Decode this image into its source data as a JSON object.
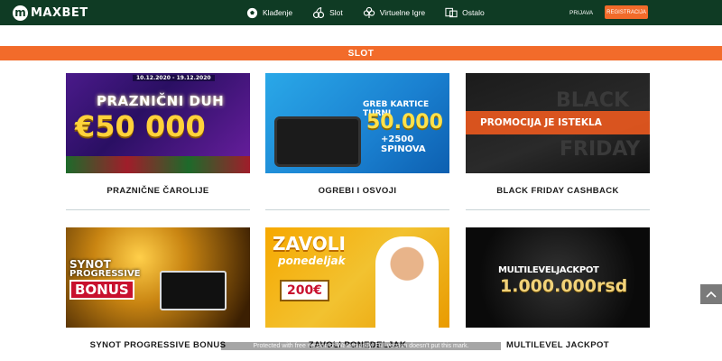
{
  "brand": {
    "logo_letter": "m",
    "name": "MAXBET"
  },
  "nav": [
    {
      "label": "Klađenje",
      "icon": "soccer-ball-icon"
    },
    {
      "label": "Slot",
      "icon": "cherries-icon"
    },
    {
      "label": "Virtuelne Igre",
      "icon": "clover-icon"
    },
    {
      "label": "Ostalo",
      "icon": "screens-icon"
    }
  ],
  "auth": {
    "login_label": "PRIJAVA",
    "register_label": "REGISTRACIJA"
  },
  "section": {
    "title": "SLOT"
  },
  "cards": [
    {
      "caption": "PRAZNIČNE ČAROLIJE",
      "banner_line1": "PRAZNIČNI DUH",
      "banner_line2": "€50 000",
      "banner_tag": "10.12.2020 - 19.12.2020"
    },
    {
      "caption": "OGREBI I OSVOJI",
      "banner_line1": "GREB KARTICE TURNI",
      "banner_line2": "50.000",
      "banner_line3": "+2500 SPINOVA"
    },
    {
      "caption": "BLACK FRIDAY CASHBACK",
      "banner_line1": "BLACK",
      "banner_line2": "PROMOCIJA JE ISTEKLA",
      "banner_line3": "FRIDAY"
    },
    {
      "caption": "SYNOT PROGRESSIVE BONUS",
      "banner_line1": "SYNOT",
      "banner_line2": "PROGRESSIVE",
      "banner_line3": "BONUS"
    },
    {
      "caption": "ZAVOLI PONEDELJAK",
      "banner_line1": "ZAVOLI",
      "banner_line2": "ponedeljak",
      "banner_line3": "200€"
    },
    {
      "caption": "MULTILEVEL JACKPOT",
      "banner_line1": "MULTILEVELJACKPOT",
      "banner_line2": "1.000.000rsd"
    }
  ],
  "watermark_text": "Protected with free version of Watermarkly. Full version doesn't put this mark.",
  "colors": {
    "topbar": "#0f3b24",
    "accent": "#f26b2a"
  }
}
